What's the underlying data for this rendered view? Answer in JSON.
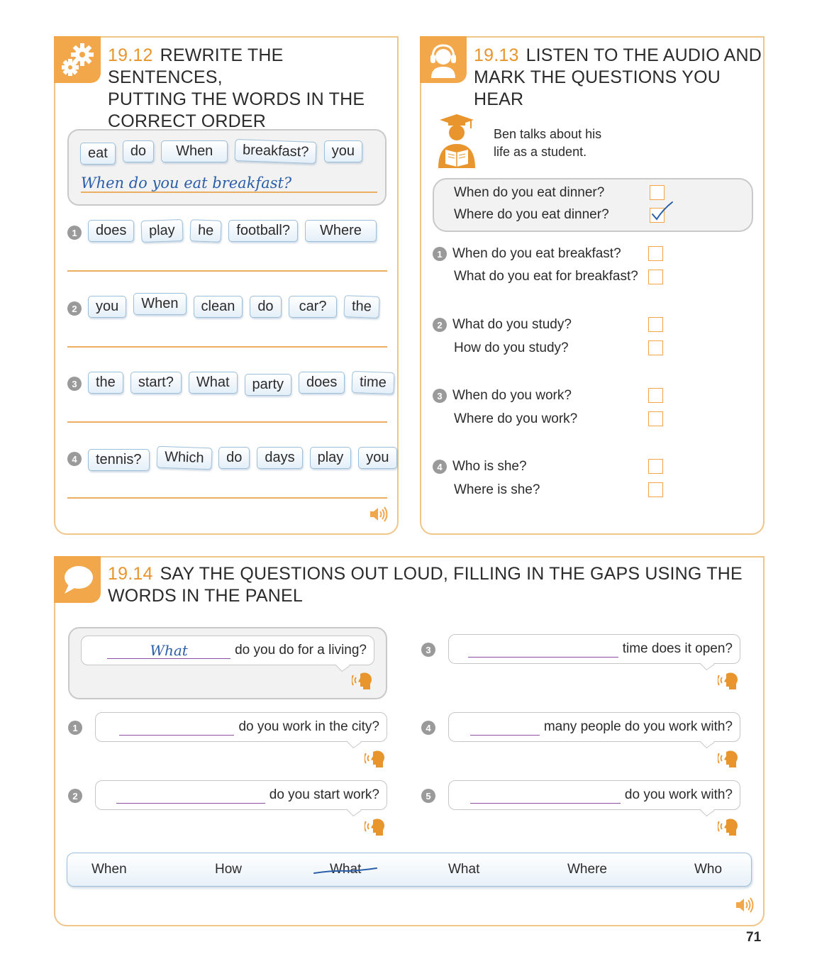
{
  "ex12": {
    "number": "19.12",
    "title_lines": [
      "REWRITE THE SENTENCES,",
      "PUTTING THE WORDS IN THE",
      "CORRECT ORDER"
    ],
    "example": {
      "words": [
        "eat",
        "do",
        "When",
        "breakfast?",
        "you"
      ],
      "answer": "When do you eat breakfast?"
    },
    "items": [
      {
        "num": "1",
        "words": [
          "does",
          "play",
          "he",
          "football?",
          "Where"
        ]
      },
      {
        "num": "2",
        "words": [
          "you",
          "When",
          "clean",
          "do",
          "car?",
          "the"
        ]
      },
      {
        "num": "3",
        "words": [
          "the",
          "start?",
          "What",
          "party",
          "does",
          "time"
        ]
      },
      {
        "num": "4",
        "words": [
          "tennis?",
          "Which",
          "do",
          "days",
          "play",
          "you"
        ]
      }
    ],
    "icon": "gears-icon"
  },
  "ex13": {
    "number": "19.13",
    "title_lines": [
      "LISTEN TO THE AUDIO AND",
      "MARK THE QUESTIONS YOU HEAR"
    ],
    "intro_lines": [
      "Ben talks about his",
      "life as a student."
    ],
    "example": [
      {
        "text": "When do you eat dinner?",
        "checked": false
      },
      {
        "text": "Where do you eat dinner?",
        "checked": true
      }
    ],
    "items": [
      {
        "num": "1",
        "q1": "When do you eat breakfast?",
        "q2": "What do you eat for breakfast?"
      },
      {
        "num": "2",
        "q1": "What do you study?",
        "q2": "How do you study?"
      },
      {
        "num": "3",
        "q1": "When do you work?",
        "q2": "Where do you work?"
      },
      {
        "num": "4",
        "q1": "Who is she?",
        "q2": "Where is she?"
      }
    ],
    "icon": "headphones-icon"
  },
  "ex14": {
    "number": "19.14",
    "title_lines": [
      "SAY THE QUESTIONS OUT LOUD, FILLING IN THE GAPS USING THE",
      "WORDS IN THE PANEL"
    ],
    "example": {
      "answer": "What",
      "text": "do you do for a living?"
    },
    "items": [
      {
        "num": "1",
        "text": "do you work in the city?"
      },
      {
        "num": "2",
        "text": "do you start work?"
      },
      {
        "num": "3",
        "text": "time does it open?"
      },
      {
        "num": "4",
        "text": "many people do you work with?"
      },
      {
        "num": "5",
        "text": "do you work with?"
      }
    ],
    "panel_words": [
      "When",
      "How",
      "What",
      "What",
      "Where",
      "Who"
    ],
    "crossed_out_index": 2,
    "icon": "speech-bubble-icon"
  },
  "page_number": "71",
  "colors": {
    "accent": "#f2a74a",
    "border": "#f0c58a",
    "tile_border": "#9dbfd9",
    "handwriting": "#2a5ea8",
    "gap_line": "#8a4fa3"
  }
}
